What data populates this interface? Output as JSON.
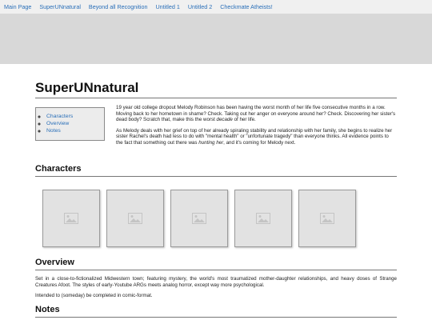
{
  "nav": [
    "Main Page",
    "SuperUNnatural",
    "Beyond all Recognition",
    "Untitled 1",
    "Untitled 2",
    "Checkmate Atheists!"
  ],
  "page": {
    "title": "SuperUNnatural"
  },
  "toc": [
    "Characters",
    "Overview",
    "Notes"
  ],
  "intro": {
    "p1": "19 year old college dropout Melody Robinson has been having the worst month of her life five consecutive months in a row. Moving back to her hometown in shame? Check. Taking out her anger on everyone around her? Check. Discovering her sister's dead body? Scratch that, make this the worst ",
    "p1_em": "decade",
    "p1_end": " of her life.",
    "p2": "As Melody deals with her grief on top of her already spiraling stability and relationship with her family, she begins to realize her sister Rachel's death had less to do with \"mental health\" or \"unfortunate tragedy\" than everyone thinks. All evidence points to the fact that something out there was ",
    "p2_em": "hunting her",
    "p2_end": ", and it's coming for Melody next."
  },
  "sections": {
    "characters": "Characters",
    "overview": "Overview",
    "notes": "Notes"
  },
  "character_cards": [
    "image-placeholder-icon",
    "image-placeholder-icon",
    "image-placeholder-icon",
    "image-placeholder-icon",
    "image-placeholder-icon"
  ],
  "overview": {
    "p1": "Set in a close-to-fictionalized Midwestern town; featuring mystery, the world's most traumatized mother-daughter relationships, and heavy doses of Strange Creatures Afoot. The styles of early-Youtube ARGs meets analog horror, except way more psychological.",
    "p2": "Intended to (someday) be completed in comic-format."
  },
  "colors": {
    "link": "#2a6fb8",
    "banner": "#d8d8d8",
    "nav_bg": "#f0f0f0"
  }
}
